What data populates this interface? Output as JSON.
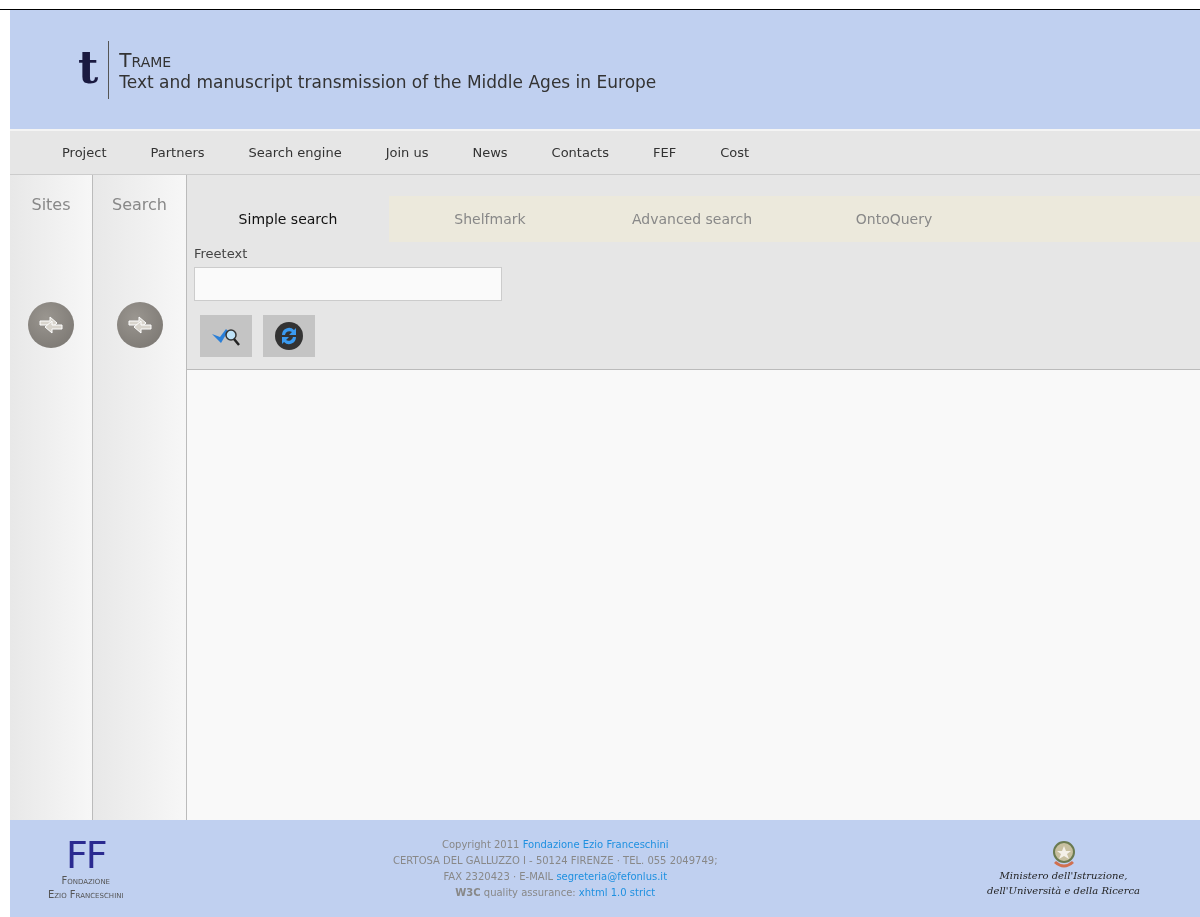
{
  "header": {
    "logo_letter": "t",
    "title": "Trame",
    "subtitle": "Text and manuscript transmission of the Middle Ages in Europe"
  },
  "nav": [
    "Project",
    "Partners",
    "Search engine",
    "Join us",
    "News",
    "Contacts",
    "FEF",
    "Cost"
  ],
  "side_panels": [
    {
      "label": "Sites"
    },
    {
      "label": "Search"
    }
  ],
  "tabs": [
    {
      "label": "Simple search",
      "selected": true
    },
    {
      "label": "Shelfmark",
      "selected": false
    },
    {
      "label": "Advanced search",
      "selected": false
    },
    {
      "label": "OntoQuery",
      "selected": false
    }
  ],
  "form": {
    "field_label": "Freetext"
  },
  "footer": {
    "left_logo": {
      "mark": "FF",
      "name_lines": [
        "Fondazione",
        "Ezio Franceschini"
      ]
    },
    "lines": [
      {
        "text": "Copyright 2011 ",
        "link": "Fondazione Ezio Franceschini"
      },
      {
        "text": "CERTOSA DEL GALLUZZO I - 50124 FIRENZE · TEL. 055 2049749;"
      },
      {
        "text": "FAX 2320423 · E-MAIL ",
        "link": "segreteria@fefonlus.it"
      },
      {
        "text": "**W3C** quality assurance: ",
        "link": "xhtml 1.0 strict"
      }
    ],
    "ministry_lines": [
      "Ministero dell'Istruzione,",
      "dell'Università e della Ricerca"
    ]
  }
}
